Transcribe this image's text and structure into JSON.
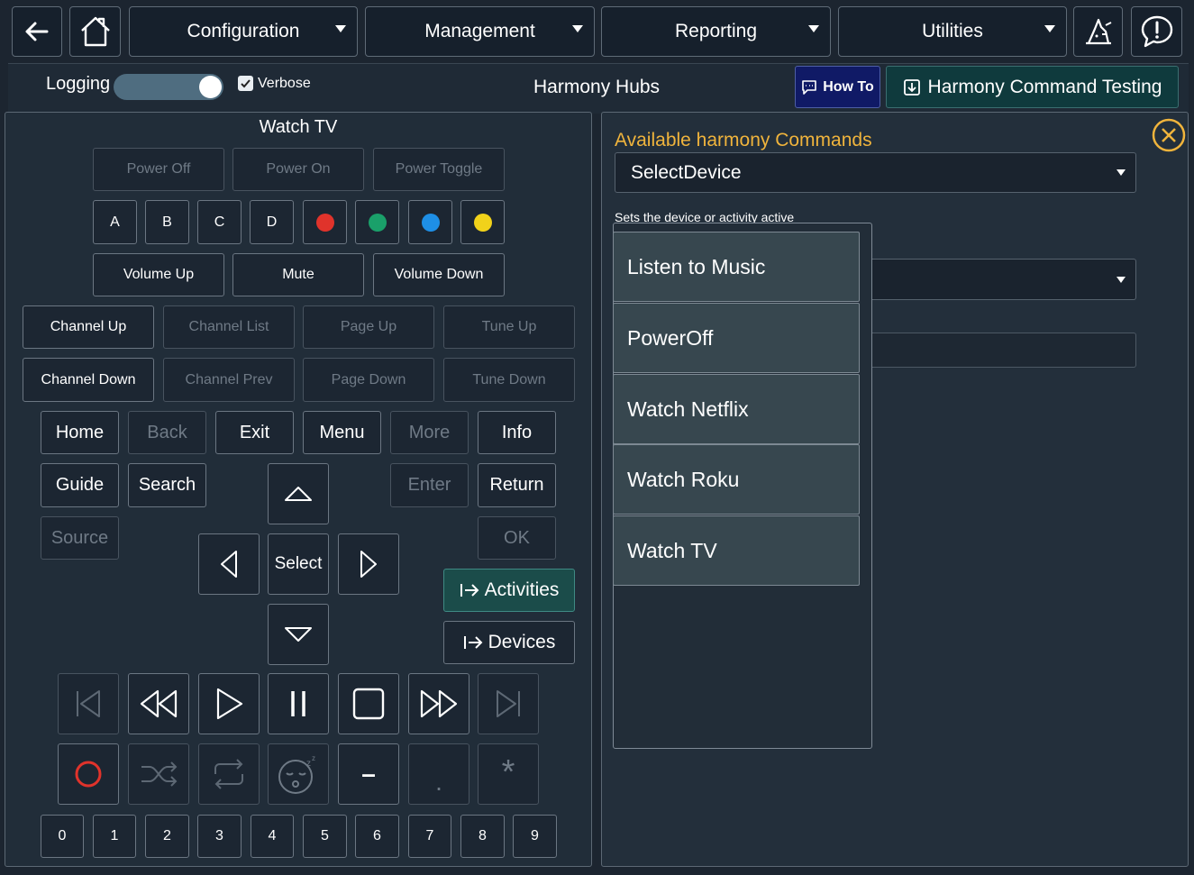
{
  "nav": {
    "configuration": "Configuration",
    "management": "Management",
    "reporting": "Reporting",
    "utilities": "Utilities"
  },
  "header": {
    "logging_label": "Logging",
    "verbose_label": "Verbose",
    "title": "Harmony Hubs",
    "how_to": "How To",
    "testing": "Harmony Command Testing",
    "logging_on": true,
    "verbose_checked": true
  },
  "remote": {
    "title": "Watch TV",
    "power": [
      "Power Off",
      "Power On",
      "Power Toggle"
    ],
    "abcd": [
      "A",
      "B",
      "C",
      "D"
    ],
    "color_dots": [
      "#e0332b",
      "#1aa06a",
      "#1e8fe6",
      "#f1d21a"
    ],
    "volume": [
      "Volume Up",
      "Mute",
      "Volume Down"
    ],
    "row1": [
      "Channel Up",
      "Channel List",
      "Page Up",
      "Tune Up"
    ],
    "row2": [
      "Channel Down",
      "Channel Prev",
      "Page Down",
      "Tune Down"
    ],
    "home": "Home",
    "back": "Back",
    "exit": "Exit",
    "menu": "Menu",
    "more": "More",
    "info": "Info",
    "guide": "Guide",
    "search": "Search",
    "enter": "Enter",
    "return": "Return",
    "source": "Source",
    "ok": "OK",
    "select": "Select",
    "activities": "Activities",
    "devices": "Devices",
    "dash": "–",
    "dot": ".",
    "star": "*",
    "numbers": [
      "0",
      "1",
      "2",
      "3",
      "4",
      "5",
      "6",
      "7",
      "8",
      "9"
    ]
  },
  "commands": {
    "label": "Available harmony Commands",
    "selected": "SelectDevice",
    "description": "Sets the device or activity active",
    "options": [
      "Listen to Music",
      "PowerOff",
      "Watch Netflix",
      "Watch Roku",
      "Watch TV"
    ]
  },
  "colors": {
    "accent_gold": "#f0b43c",
    "how_to_bg": "#101a66",
    "testing_bg": "#0f3a3d",
    "activities_bg": "#1b4c4a"
  }
}
